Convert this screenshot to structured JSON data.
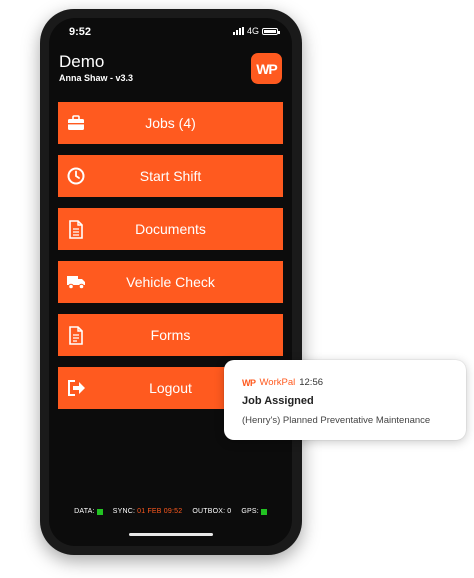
{
  "status_bar": {
    "time": "9:52",
    "network": "4G"
  },
  "header": {
    "title": "Demo",
    "subtitle": "Anna Shaw - v3.3",
    "logo_text": "WP"
  },
  "menu": [
    {
      "label": "Jobs (4)",
      "icon": "briefcase-icon"
    },
    {
      "label": "Start Shift",
      "icon": "clock-icon"
    },
    {
      "label": "Documents",
      "icon": "document-icon"
    },
    {
      "label": "Vehicle Check",
      "icon": "truck-icon"
    },
    {
      "label": "Forms",
      "icon": "form-icon"
    },
    {
      "label": "Logout",
      "icon": "logout-icon"
    }
  ],
  "footer": {
    "data_label": "DATA:",
    "sync_label": "SYNC:",
    "sync_value": "01 FEB 09:52",
    "outbox_label": "OUTBOX:",
    "outbox_value": "0",
    "gps_label": "GPS:"
  },
  "notification": {
    "logo": "WP",
    "app": "WorkPal",
    "time": "12:56",
    "title": "Job Assigned",
    "body": "(Henry's) Planned Preventative Maintenance"
  },
  "colors": {
    "accent": "#ff5a1f",
    "background": "#0c0c0c",
    "status_ok": "#22c322"
  }
}
